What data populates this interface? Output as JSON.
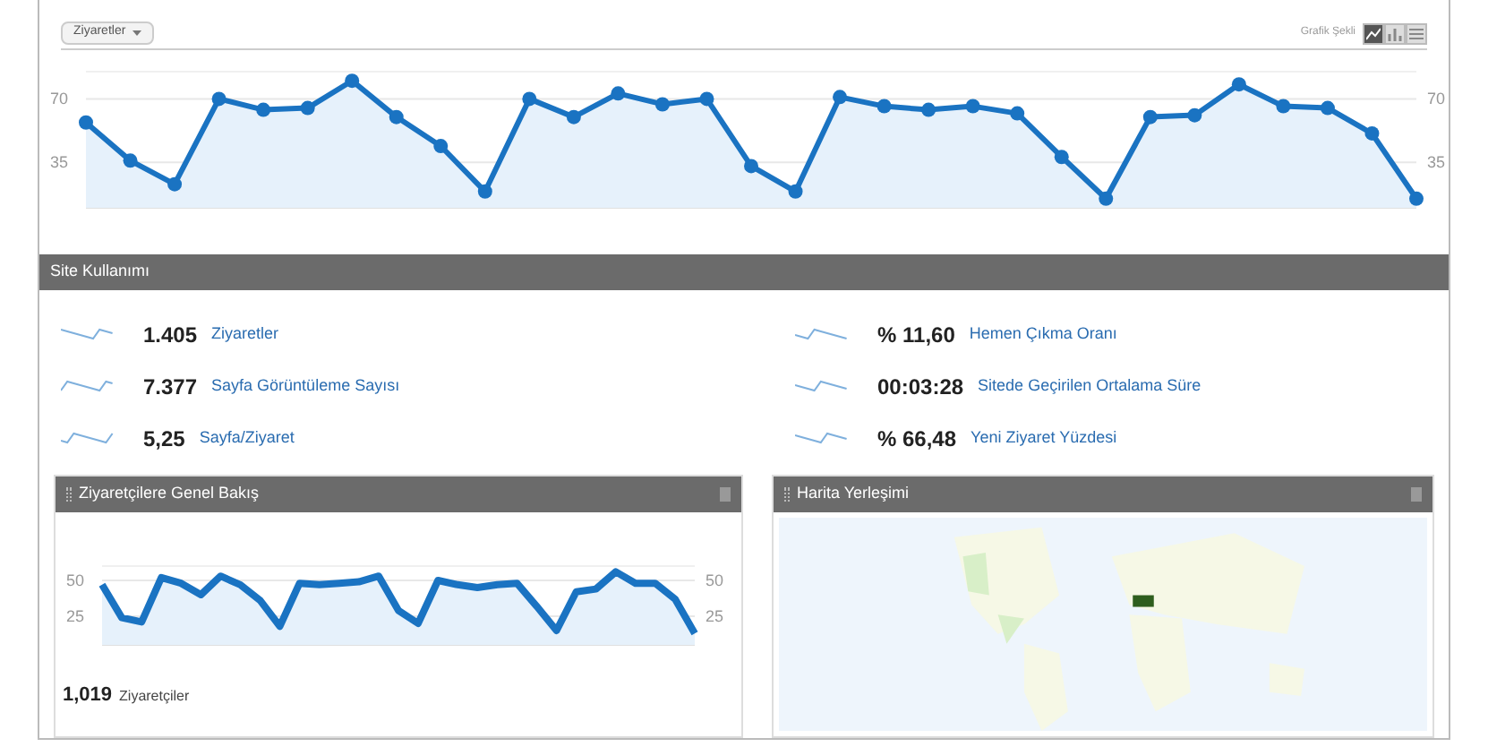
{
  "toolbar": {
    "metric_dropdown": "Ziyaretler",
    "scale_label": "Grafik Şekli",
    "view_buttons": [
      {
        "kind": "line",
        "selected": true
      },
      {
        "kind": "bar",
        "selected": false
      },
      {
        "kind": "table",
        "selected": false
      }
    ]
  },
  "main_chart": {
    "right_axis_labels": [
      "70",
      "35"
    ],
    "chart_data": {
      "type": "area",
      "ylim": [
        10,
        85
      ],
      "yticks": [
        35,
        70
      ],
      "series": [
        {
          "color": "#1a73c2",
          "values": [
            57,
            36,
            23,
            70,
            64,
            65,
            80,
            60,
            44,
            19,
            70,
            60,
            73,
            67,
            70,
            33,
            19,
            71,
            66,
            64,
            66,
            62,
            38,
            15,
            60,
            61,
            78,
            66,
            65,
            51,
            15
          ]
        }
      ]
    }
  },
  "site_usage": {
    "title": "Site Kullanımı",
    "metrics": [
      {
        "value": "1.405",
        "label": "Ziyaretler"
      },
      {
        "value": "% 11,60",
        "label": "Hemen Çıkma Oranı"
      },
      {
        "value": "7.377",
        "label": "Sayfa Görüntüleme Sayısı"
      },
      {
        "value": "00:03:28",
        "label": "Sitede Geçirilen Ortalama Süre"
      },
      {
        "value": "5,25",
        "label": "Sayfa/Ziyaret"
      },
      {
        "value": "% 66,48",
        "label": "Yeni Ziyaret Yüzdesi"
      }
    ]
  },
  "visitors_panel": {
    "title": "Ziyaretçilere Genel Bakış",
    "right_axis_labels": [
      "50",
      "25"
    ],
    "chart_data": {
      "type": "area",
      "ylim": [
        5,
        60
      ],
      "yticks": [
        25,
        50
      ],
      "series": [
        {
          "color": "#1a73c2",
          "values": [
            47,
            24,
            21,
            52,
            48,
            40,
            53,
            47,
            36,
            18,
            48,
            47,
            48,
            49,
            53,
            29,
            20,
            50,
            47,
            45,
            47,
            48,
            32,
            15,
            42,
            44,
            56,
            48,
            48,
            37,
            13
          ]
        }
      ]
    },
    "total": "1,019",
    "total_label": "Ziyaretçiler"
  },
  "map_panel": {
    "title": "Harita Yerleşimi"
  }
}
